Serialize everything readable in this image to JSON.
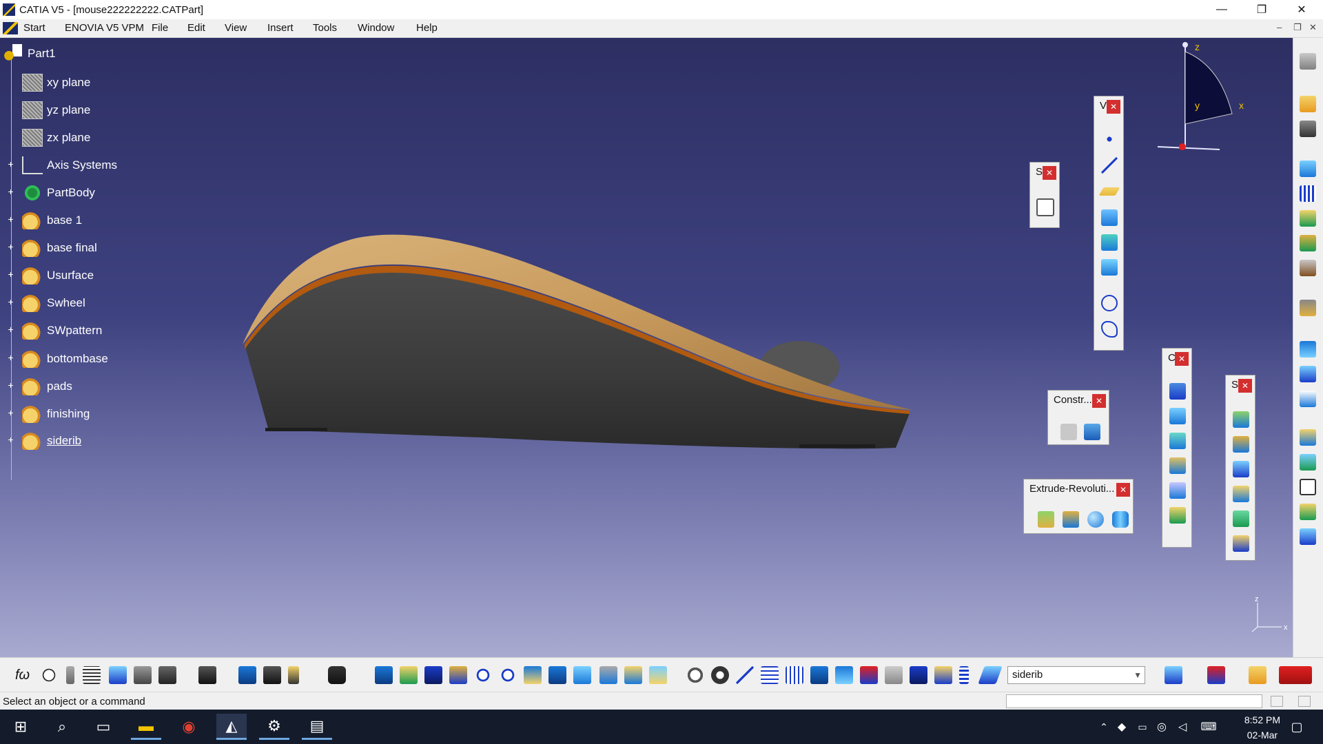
{
  "window": {
    "title": "CATIA V5 - [mouse222222222.CATPart]",
    "minimize": "—",
    "maximize": "❐",
    "close": "✕"
  },
  "menu": {
    "items": [
      "Start",
      "ENOVIA V5 VPM",
      "File",
      "Edit",
      "View",
      "Insert",
      "Tools",
      "Window",
      "Help"
    ],
    "mdi_min": "–",
    "mdi_restore": "❐",
    "mdi_close": "✕"
  },
  "tree": {
    "root": "Part1",
    "items": [
      {
        "label": "xy plane",
        "icon": "plane-icon"
      },
      {
        "label": "yz plane",
        "icon": "plane-icon"
      },
      {
        "label": "zx plane",
        "icon": "plane-icon"
      },
      {
        "label": "Axis Systems",
        "icon": "axis-systems-icon"
      },
      {
        "label": "PartBody",
        "icon": "partbody-icon"
      },
      {
        "label": "base 1",
        "icon": "geometrical-set-icon"
      },
      {
        "label": "base final",
        "icon": "geometrical-set-icon"
      },
      {
        "label": "Usurface",
        "icon": "geometrical-set-icon"
      },
      {
        "label": "Swheel",
        "icon": "geometrical-set-icon"
      },
      {
        "label": "SWpattern",
        "icon": "geometrical-set-icon"
      },
      {
        "label": "bottombase",
        "icon": "geometrical-set-icon"
      },
      {
        "label": "pads",
        "icon": "geometrical-set-icon"
      },
      {
        "label": "finishing",
        "icon": "geometrical-set-icon"
      },
      {
        "label": "siderib",
        "icon": "geometrical-set-icon"
      }
    ]
  },
  "compass": {
    "z": "z",
    "x": "x",
    "y": "y"
  },
  "mini_axis": {
    "z": "z",
    "x": "x"
  },
  "panels": {
    "wireframe": {
      "title": "V"
    },
    "sketcher": {
      "title": "S"
    },
    "constraints": {
      "title": "Constr..."
    },
    "extrude": {
      "title": "Extrude-Revoluti..."
    },
    "operations": {
      "title": "C"
    },
    "surfaces": {
      "title": "S"
    }
  },
  "bottom_toolbar": {
    "formula_label": "fω",
    "current_set": "siderib"
  },
  "status": {
    "message": "Select an object or a command"
  },
  "taskbar": {
    "time": "8:52 PM",
    "date": "02-Mar"
  },
  "colors": {
    "viewport_top": "#2d2f63",
    "viewport_bottom": "#a9aad0",
    "mouse_shell": "#c89a5c",
    "mouse_body": "#3c3c3c",
    "seam": "#b15a10"
  }
}
